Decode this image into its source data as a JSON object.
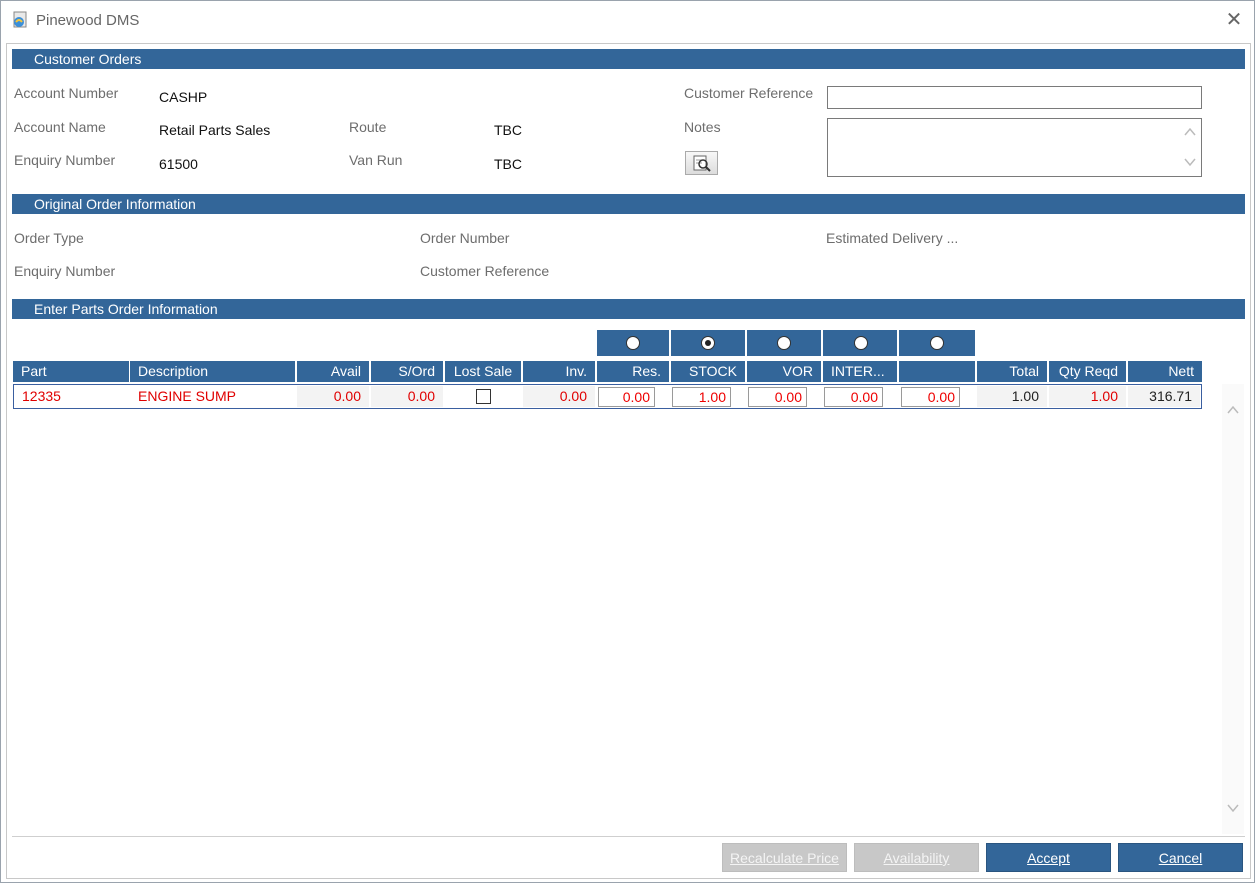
{
  "window": {
    "title": "Pinewood DMS"
  },
  "customer_orders": {
    "section_title": "Customer Orders",
    "account_number_label": "Account Number",
    "account_number": "CASHP",
    "account_name_label": "Account Name",
    "account_name": "Retail Parts Sales",
    "enquiry_number_label": "Enquiry Number",
    "enquiry_number": "61500",
    "route_label": "Route",
    "route": "TBC",
    "van_run_label": "Van Run",
    "van_run": "TBC",
    "customer_reference_label": "Customer Reference",
    "customer_reference": "",
    "notes_label": "Notes",
    "notes": ""
  },
  "original_order": {
    "section_title": "Original Order Information",
    "order_type_label": "Order Type",
    "order_number_label": "Order Number",
    "estimated_delivery_label": "Estimated Delivery ...",
    "enquiry_number_label": "Enquiry Number",
    "customer_reference_label": "Customer Reference"
  },
  "parts_order": {
    "section_title": "Enter Parts Order Information",
    "selected_radio": "STOCK",
    "columns": [
      "Part",
      "Description",
      "Avail",
      "S/Ord",
      "Lost Sale",
      "Inv.",
      "Res.",
      "STOCK",
      "VOR",
      "INTER...",
      "",
      "Total",
      "Qty Reqd",
      "Nett"
    ],
    "rows": [
      {
        "part": "12335",
        "description": "ENGINE SUMP",
        "avail": "0.00",
        "s_ord": "0.00",
        "lost_sale": false,
        "inv": "0.00",
        "res": "0.00",
        "stock": "1.00",
        "vor": "0.00",
        "inter": "0.00",
        "blank": "0.00",
        "total": "1.00",
        "qty_reqd": "1.00",
        "nett": "316.71"
      }
    ]
  },
  "buttons": {
    "recalculate": "Recalculate Price",
    "availability": "Availability",
    "accept": "Accept",
    "cancel": "Cancel"
  },
  "colors": {
    "section_bar": "#336699",
    "highlight_text": "#e00000"
  }
}
